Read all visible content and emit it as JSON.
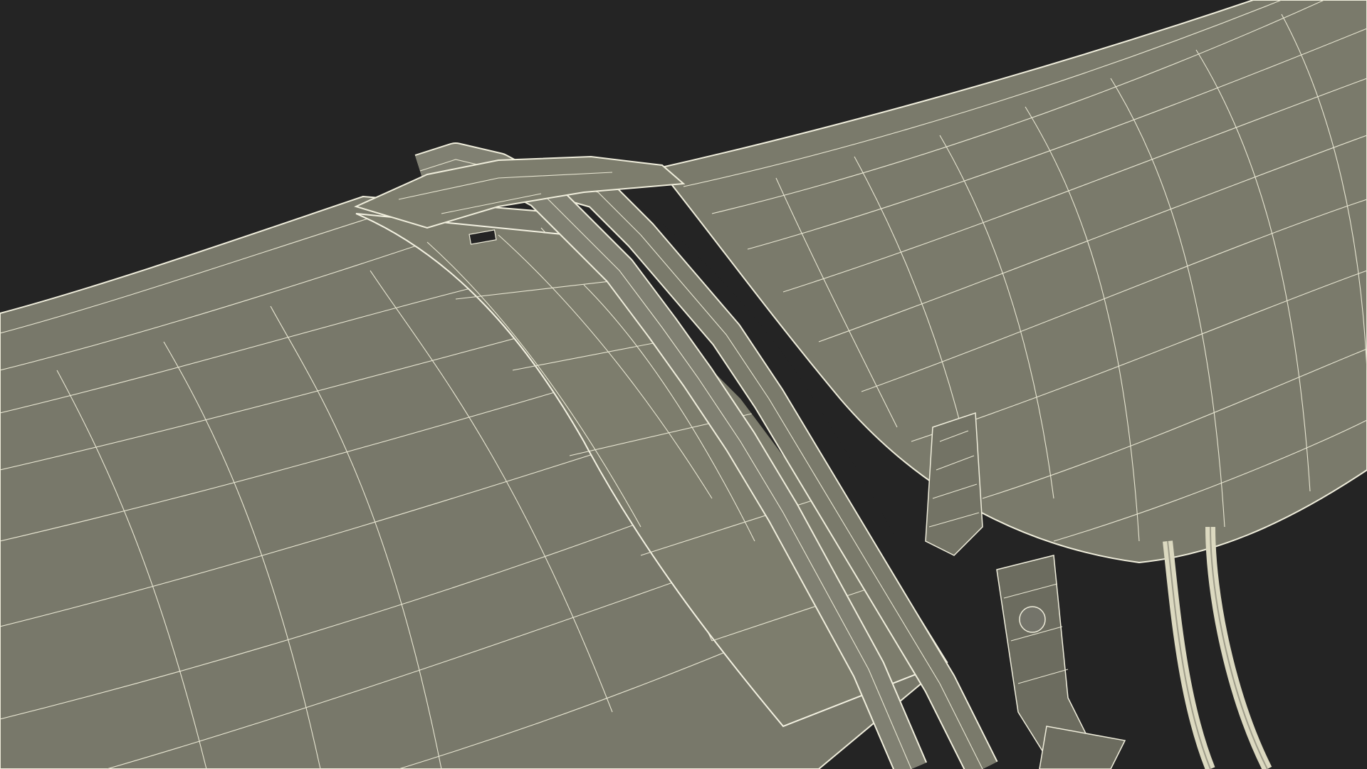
{
  "scene": {
    "colors": {
      "background": "#242424",
      "surface": "#78786a",
      "surface_light": "#82826f",
      "surface_dark": "#6c6c5f",
      "wireframe": "#f0eedc",
      "cable": "#dcd9c0"
    }
  }
}
